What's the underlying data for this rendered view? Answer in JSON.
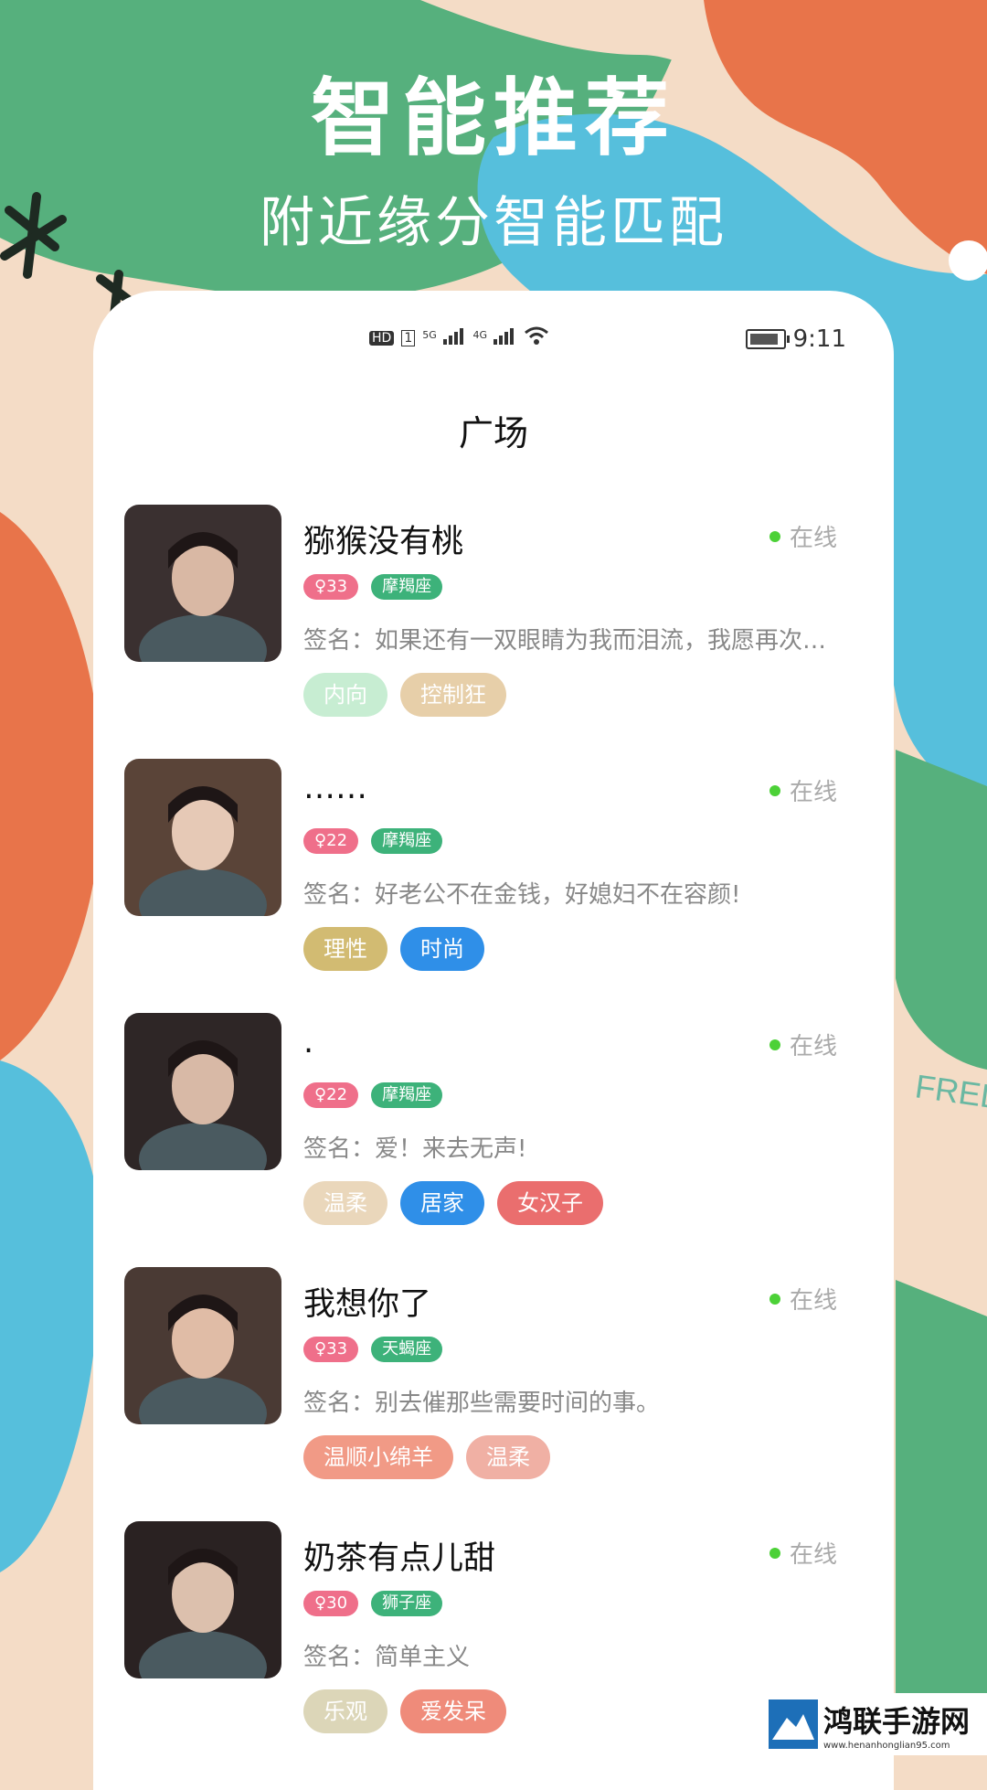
{
  "hero": {
    "title": "智能推荐",
    "subtitle": "附近缘分智能匹配"
  },
  "status_bar": {
    "left_icons": [
      "HD",
      "5G signal",
      "4G signal",
      "wifi"
    ],
    "hd_label": "HD",
    "sim_label": "1",
    "net1_label": "5G",
    "net2_label": "4G",
    "time": "9:11"
  },
  "page_title": "广场",
  "colors": {
    "green_bg": "#56b07d",
    "orange_bg": "#e8744a",
    "blue_bg": "#56bfdc",
    "peach_bg": "#f4dcc6",
    "online_dot": "#4cd137",
    "age_badge": "#ef6f8a",
    "constellation_badge": "#3db27a"
  },
  "users": [
    {
      "name": "猕猴没有桃",
      "status": "在线",
      "age": "♀33",
      "constellation": "摩羯座",
      "signature": "签名：如果还有一双眼睛为我而泪流，我愿再次…",
      "tags": [
        {
          "label": "内向",
          "color": "#c7edd2"
        },
        {
          "label": "控制狂",
          "color": "#e7cfa9"
        }
      ]
    },
    {
      "name": "……",
      "status": "在线",
      "age": "♀22",
      "constellation": "摩羯座",
      "signature": "签名：好老公不在金钱，好媳妇不在容颜!",
      "tags": [
        {
          "label": "理性",
          "color": "#d2bb72"
        },
        {
          "label": "时尚",
          "color": "#2f8fe8"
        }
      ]
    },
    {
      "name": ".",
      "status": "在线",
      "age": "♀22",
      "constellation": "摩羯座",
      "signature": "签名：爱！来去无声!",
      "tags": [
        {
          "label": "温柔",
          "color": "#ead7bb"
        },
        {
          "label": "居家",
          "color": "#2f8fe8"
        },
        {
          "label": "女汉子",
          "color": "#ea6e6e"
        }
      ]
    },
    {
      "name": "我想你了",
      "status": "在线",
      "age": "♀33",
      "constellation": "天蝎座",
      "signature": "签名：别去催那些需要时间的事。",
      "tags": [
        {
          "label": "温顺小绵羊",
          "color": "#f19a86"
        },
        {
          "label": "温柔",
          "color": "#f0b0a4"
        }
      ]
    },
    {
      "name": "奶茶有点儿甜",
      "status": "在线",
      "age": "♀30",
      "constellation": "狮子座",
      "signature": "签名：简单主义",
      "tags": [
        {
          "label": "乐观",
          "color": "#dcd6b8"
        },
        {
          "label": "爱发呆",
          "color": "#ef8b7a"
        }
      ]
    }
  ],
  "watermark": {
    "main": "鸿联手游网",
    "url": "www.henanhonglian95.com",
    "side_text": "FRED"
  }
}
